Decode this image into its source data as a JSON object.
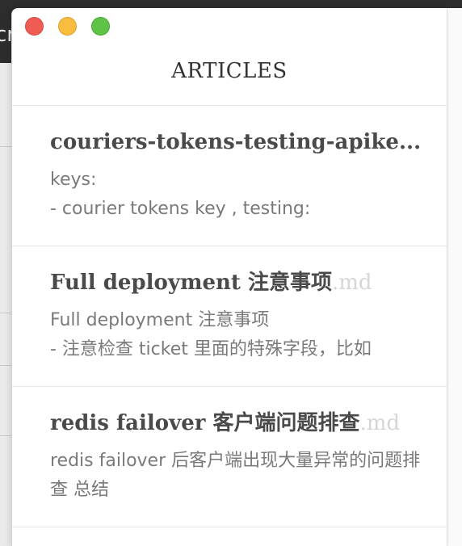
{
  "background": {
    "top_text": "cr"
  },
  "window": {
    "header_title": "ARTICLES"
  },
  "articles": [
    {
      "title": "couriers-tokens-testing-apikeys.md",
      "title_display": "couriers-tokens-testing-apike...",
      "ext": "",
      "preview": "keys:\n- courier tokens key , testing:"
    },
    {
      "title_display": "Full deployment 注意事项",
      "ext": ".md",
      "preview": "Full deployment 注意事项\n- 注意检查 ticket 里面的特殊字段，比如"
    },
    {
      "title_display": "redis failover 客户端问题排查",
      "ext": ".md",
      "preview": "redis failover 后客户端出现大量异常的问题排查 总结"
    }
  ],
  "colors": {
    "close": "#ee5c54",
    "minimize": "#f8bd3f",
    "maximize": "#5ec346"
  }
}
